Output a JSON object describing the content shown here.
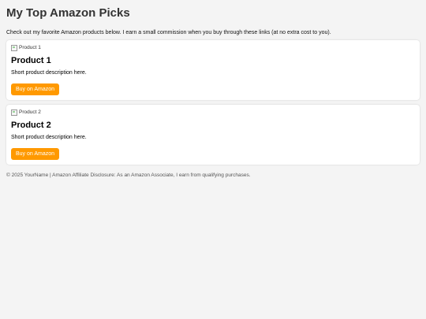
{
  "header": {
    "title": "My Top Amazon Picks"
  },
  "intro": "Check out my favorite Amazon products below. I earn a small commission when you buy through these links (at no extra cost to you).",
  "products": [
    {
      "image_alt": "Product 1",
      "title": "Product 1",
      "description": "Short product description here.",
      "button_label": "Buy on Amazon"
    },
    {
      "image_alt": "Product 2",
      "title": "Product 2",
      "description": "Short product description here.",
      "button_label": "Buy on Amazon"
    }
  ],
  "footer": "© 2025 YourName | Amazon Affiliate Disclosure: As an Amazon Associate, I earn from qualifying purchases.",
  "colors": {
    "button_bg": "#ff9900",
    "page_bg": "#f4f4f4",
    "card_bg": "#ffffff"
  },
  "icons": {
    "broken_image": "broken-image-icon"
  }
}
